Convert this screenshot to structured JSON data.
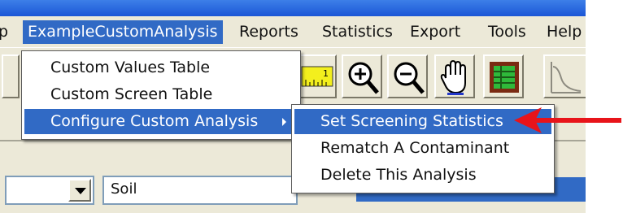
{
  "menubar": {
    "items": [
      {
        "label": "ExampleCustomAnalysis",
        "active": true
      },
      {
        "label": "Reports"
      },
      {
        "label": "Statistics"
      },
      {
        "label": "Export"
      },
      {
        "label": "Tools"
      },
      {
        "label": "Help"
      }
    ]
  },
  "dropdown": {
    "items": [
      {
        "label": "Custom Values Table"
      },
      {
        "label": "Custom Screen Table"
      },
      {
        "label": "Configure Custom Analysis",
        "has_submenu": true,
        "highlighted": true
      }
    ]
  },
  "submenu": {
    "items": [
      {
        "label": "Set Screening Statistics",
        "highlighted": true
      },
      {
        "label": "Rematch A Contaminant"
      },
      {
        "label": "Delete This Analysis"
      }
    ]
  },
  "toolbar": {
    "icons": [
      "ruler-icon",
      "zoom-in-icon",
      "zoom-out-icon",
      "pan-hand-icon",
      "grid-table-icon",
      "curve-chart-icon"
    ]
  },
  "fields": {
    "soil_value": "Soil"
  },
  "annotation": {
    "arrow_color": "#e8141a"
  },
  "colors": {
    "highlight": "#316ac5",
    "menubar": "#ece9d8",
    "titlebar": "#1b56d6"
  }
}
